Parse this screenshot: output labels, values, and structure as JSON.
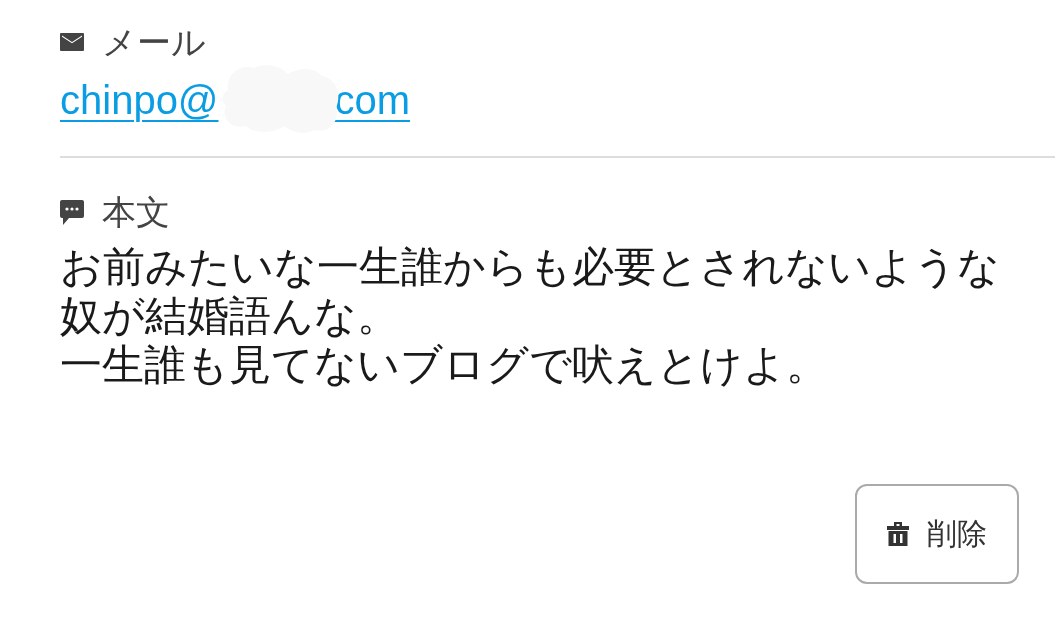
{
  "mail": {
    "label": "メール",
    "address_start": "chinpo@",
    "address_end": "com",
    "redacted": true
  },
  "body": {
    "label": "本文",
    "lines": [
      "お前みたいな一生誰からも必要とされないような",
      "奴が結婚語んな。",
      "一生誰も見てないブログで吠えとけよ。"
    ]
  },
  "delete_button": {
    "label": "削除"
  }
}
